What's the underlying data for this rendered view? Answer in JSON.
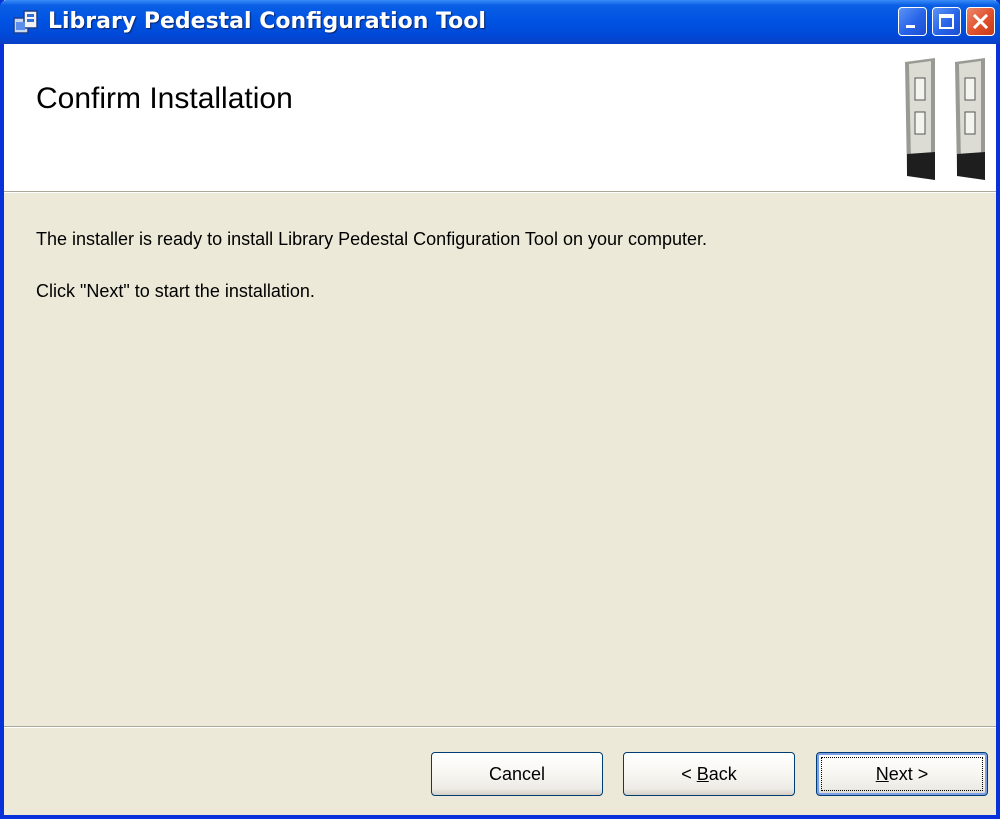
{
  "window": {
    "title": "Library Pedestal Configuration Tool",
    "title_buttons": [
      "minimize-icon",
      "maximize-icon",
      "close-icon"
    ]
  },
  "banner": {
    "title": "Confirm Installation",
    "graphic": "security-pedestals-graphic"
  },
  "body": {
    "line1": "The installer is ready to install Library Pedestal Configuration Tool on your computer.",
    "line2": "Click \"Next\" to start the installation."
  },
  "buttons": {
    "cancel": "Cancel",
    "back_prefix": "< ",
    "back_accel": "B",
    "back_rest": "ack",
    "next_accel": "N",
    "next_rest": "ext >"
  },
  "colors": {
    "title_bar": "#0054e3",
    "dialog_bg": "#ece9d8",
    "banner_bg": "#ffffff",
    "close_button": "#e0502c"
  }
}
